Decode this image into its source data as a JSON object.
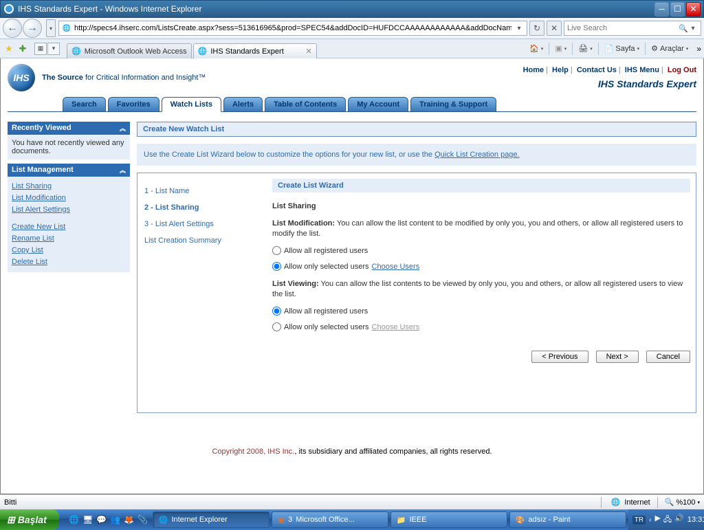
{
  "window": {
    "title": "IHS Standards Expert - Windows Internet Explorer"
  },
  "address_bar": {
    "url": "http://specs4.ihserc.com/ListsCreate.aspx?sess=513616965&prod=SPEC54&addDocID=HUFDCCAAAAAAAAAAAA&addDocNam"
  },
  "search_box": {
    "placeholder": "Live Search"
  },
  "browser_tabs": {
    "tab1": "Microsoft Outlook Web Access",
    "tab2": "IHS Standards Expert"
  },
  "ie_tools": {
    "sayfa": "Sayfa",
    "araclar": "Araçlar"
  },
  "top_links": {
    "home": "Home",
    "help": "Help",
    "contact": "Contact Us",
    "menu": "IHS Menu",
    "logout": "Log Out"
  },
  "brand": {
    "source": "The Source",
    "tagline": " for Critical Information and Insight™",
    "sub": "IHS Standards Expert"
  },
  "main_tabs": {
    "t0": "Search",
    "t1": "Favorites",
    "t2": "Watch Lists",
    "t3": "Alerts",
    "t4": "Table of Contents",
    "t5": "My Account",
    "t6": "Training & Support"
  },
  "left": {
    "recent_head": "Recently Viewed",
    "recent_note": "You have not recently viewed any documents.",
    "mgmt_head": "List Management",
    "links": {
      "sharing": "List Sharing",
      "modification": "List Modification",
      "alert": "List Alert Settings",
      "create": "Create New List",
      "rename": "Rename List",
      "copy": "Copy List",
      "delete": "Delete List"
    }
  },
  "page_title": "Create New Watch List",
  "intro": {
    "text": "Use the Create List Wizard below to customize the options for your new list, or use the ",
    "link": "Quick List Creation page."
  },
  "wizard": {
    "steps": {
      "s1": "1 - List Name",
      "s2": "2 - List Sharing",
      "s3": "3 - List Alert Settings",
      "s4": "List Creation Summary"
    },
    "head": "Create List Wizard",
    "section_title": "List Sharing",
    "mod_label": "List Modification:",
    "mod_text": " You can allow the list content to be modified by only you, you and others, or allow all registered users to modify the list.",
    "opt_all": "Allow all registered users",
    "opt_sel": "Allow only selected users ",
    "choose": "Choose Users",
    "view_label": "List Viewing:",
    "view_text": " You can allow the list contents to be viewed by only you, you and others, or allow all registered users to view the list.",
    "btn_prev": "< Previous",
    "btn_next": "Next >",
    "btn_cancel": "Cancel"
  },
  "copyright": {
    "red": "Copyright 2008, IHS Inc.",
    "rest": ", its subsidiary and affiliated companies, all rights reserved."
  },
  "status": {
    "done": "Bitti",
    "zone": "Internet",
    "zoom": "%100"
  },
  "taskbar": {
    "start": "Başlat",
    "t1": "Internet Explorer",
    "t2_prefix": "3 ",
    "t2": "Microsoft Office...",
    "t3": "IEEE",
    "t4": "adsız - Paint",
    "lang": "TR",
    "time": "13:31"
  }
}
